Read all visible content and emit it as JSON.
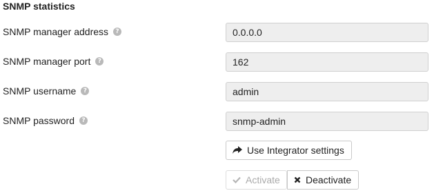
{
  "section": {
    "title": "SNMP statistics"
  },
  "fields": [
    {
      "label": "SNMP manager address",
      "value": "0.0.0.0"
    },
    {
      "label": "SNMP manager port",
      "value": "162"
    },
    {
      "label": "SNMP username",
      "value": "admin"
    },
    {
      "label": "SNMP password",
      "value": "snmp-admin"
    }
  ],
  "help_glyph": "?",
  "buttons": {
    "integrator": "Use Integrator settings",
    "activate": "Activate",
    "deactivate": "Deactivate"
  },
  "icons": {
    "integrator": "share-arrow-icon",
    "activate": "check-icon",
    "deactivate": "times-icon",
    "help": "question-circle-icon"
  },
  "colors": {
    "field_bg": "#eeeeee",
    "help_icon": "#b9b9b9",
    "disabled_text": "#aaaaaa"
  }
}
